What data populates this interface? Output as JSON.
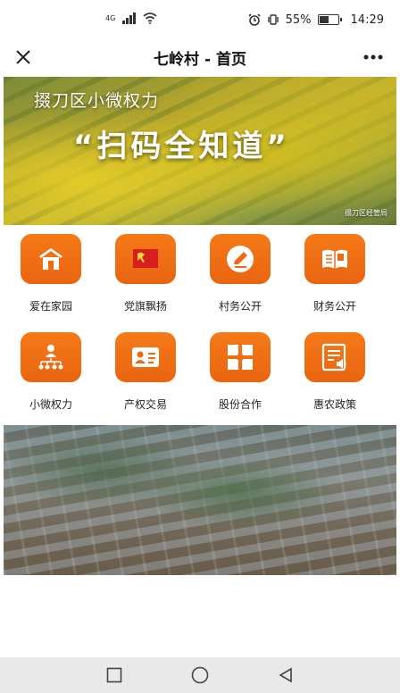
{
  "status_bar": {
    "network": "4G",
    "battery": "55%",
    "battery_level": 0.55,
    "time": "14:29"
  },
  "nav": {
    "title": "七岭村 - 首页",
    "close_icon": "close-icon",
    "more_icon": "more-icon"
  },
  "banner": {
    "line1": "掇刀区小微权力",
    "line2": "“扫码全知道”",
    "credit": "掇刀区经管局"
  },
  "grid": {
    "items": [
      {
        "label": "爱在家园",
        "icon": "home-icon"
      },
      {
        "label": "党旗飘扬",
        "icon": "party-flag-icon"
      },
      {
        "label": "村务公开",
        "icon": "edit-icon"
      },
      {
        "label": "财务公开",
        "icon": "book-icon"
      },
      {
        "label": "小微权力",
        "icon": "org-chart-icon"
      },
      {
        "label": "产权交易",
        "icon": "id-card-icon"
      },
      {
        "label": "股份合作",
        "icon": "petals-icon"
      },
      {
        "label": "惠农政策",
        "icon": "policy-doc-icon"
      }
    ]
  },
  "colors": {
    "accent_orange": "#f07014",
    "nav_bg": "#e9e9e9"
  }
}
